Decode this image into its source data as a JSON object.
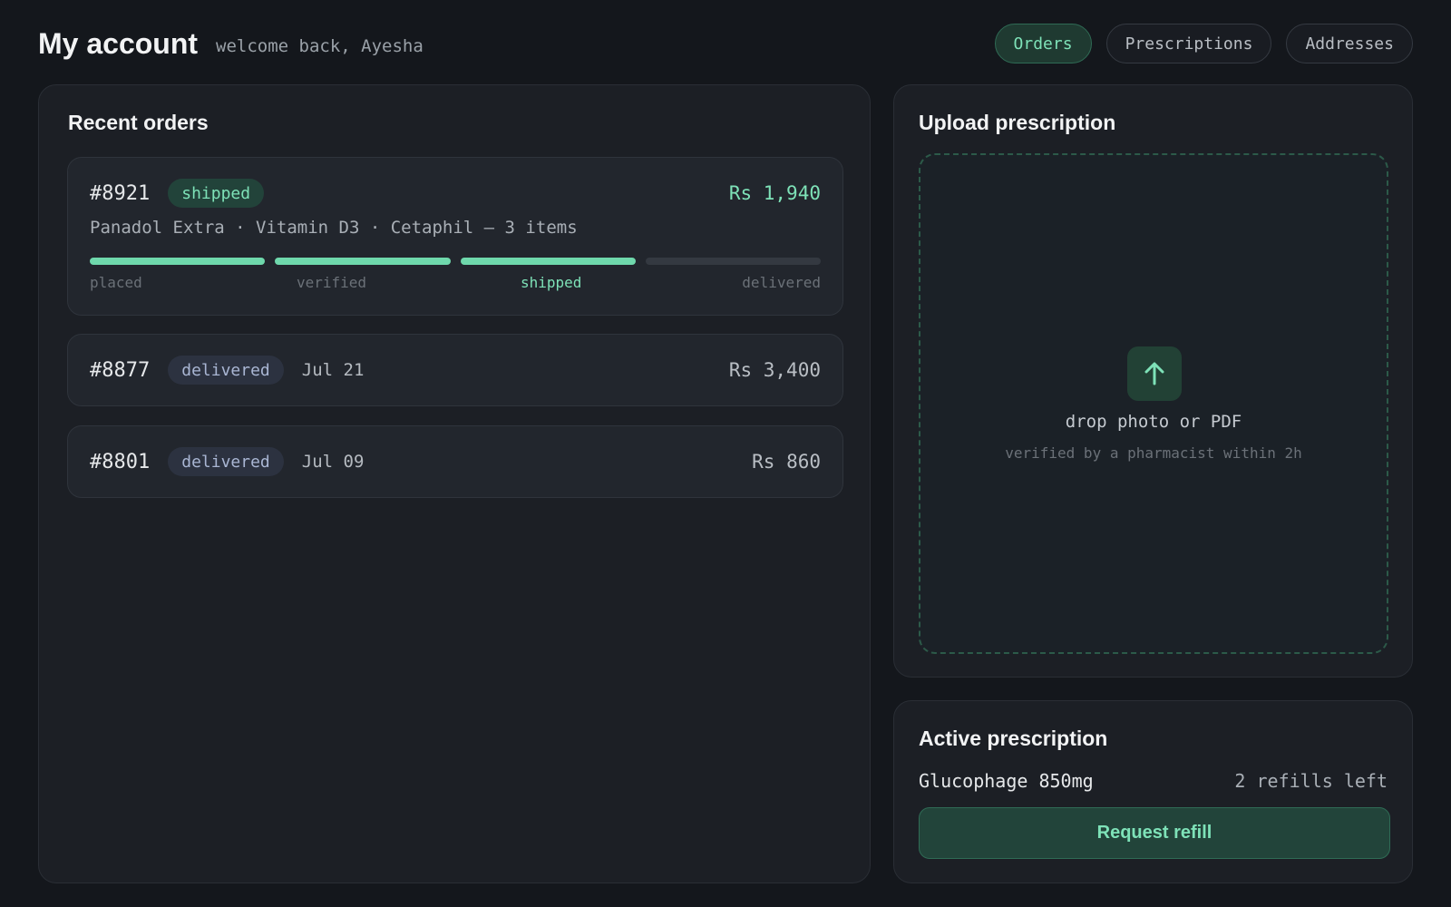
{
  "header": {
    "title": "My account",
    "welcome": "welcome back, Ayesha",
    "nav": [
      {
        "label": "Orders",
        "active": true
      },
      {
        "label": "Prescriptions",
        "active": false
      },
      {
        "label": "Addresses",
        "active": false
      }
    ]
  },
  "orders": {
    "title": "Recent orders",
    "items": [
      {
        "id": "#8921",
        "status": "shipped",
        "total": "Rs 1,940",
        "items_text": "Panadol Extra · Vitamin D3 · Cetaphil — 3 items",
        "progress": {
          "steps": [
            "placed",
            "verified",
            "shipped",
            "delivered"
          ],
          "completed": 3,
          "current": "shipped"
        }
      },
      {
        "id": "#8877",
        "status": "delivered",
        "date": "Jul 21",
        "total": "Rs 3,400"
      },
      {
        "id": "#8801",
        "status": "delivered",
        "date": "Jul 09",
        "total": "Rs 860"
      }
    ]
  },
  "upload": {
    "title": "Upload prescription",
    "icon": "upload-arrow-icon",
    "drop_label": "drop photo or PDF",
    "drop_sub": "verified by a pharmacist within 2h"
  },
  "active_rx": {
    "title": "Active prescription",
    "medication": "Glucophage 850mg",
    "refills": "2 refills left",
    "button_label": "Request refill"
  },
  "colors": {
    "background": "#14171c",
    "card": "#1c1f25",
    "accent": "#7ee2b8",
    "accent_bg": "#22443a",
    "delivered_badge": "#a9b6d3"
  }
}
